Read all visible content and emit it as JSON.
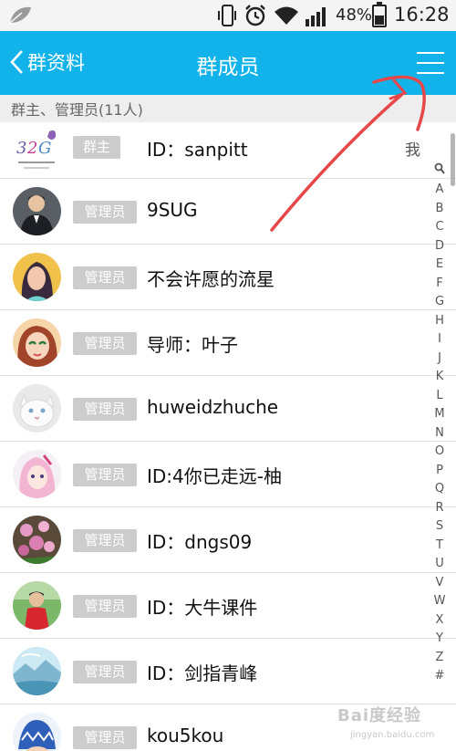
{
  "status_bar": {
    "battery_text": "48%",
    "battery_level": 0.48,
    "time": "16:28",
    "icons": [
      "leaf-icon",
      "vibrate-icon",
      "alarm-icon",
      "wifi-icon",
      "signal-icon",
      "battery-icon"
    ]
  },
  "nav": {
    "back_label": "群资料",
    "title": "群成员",
    "menu_icon": "menu-icon"
  },
  "section": {
    "title": "群主、管理员(11人)"
  },
  "members": [
    {
      "role": "群主",
      "name": "ID：sanpitt",
      "me": "我"
    },
    {
      "role": "管理员",
      "name": "9SUG"
    },
    {
      "role": "管理员",
      "name": "不会许愿的流星"
    },
    {
      "role": "管理员",
      "name": "导师：叶子"
    },
    {
      "role": "管理员",
      "name": "huweidzhuche"
    },
    {
      "role": "管理员",
      "name": "ID:4你已走远-柚"
    },
    {
      "role": "管理员",
      "name": "ID：dngs09"
    },
    {
      "role": "管理员",
      "name": "ID：大牛课件"
    },
    {
      "role": "管理员",
      "name": "ID：剑指青峰"
    },
    {
      "role": "管理员",
      "name": "kou5kou"
    }
  ],
  "index_letters": [
    "A",
    "B",
    "C",
    "D",
    "E",
    "F",
    "G",
    "H",
    "I",
    "J",
    "K",
    "L",
    "M",
    "N",
    "O",
    "P",
    "Q",
    "R",
    "S",
    "T",
    "U",
    "V",
    "W",
    "X",
    "Y",
    "Z",
    "#"
  ],
  "watermark": {
    "text": "Bai度经验",
    "subtext": "jingyan.baidu.com"
  },
  "colors": {
    "nav_bg": "#12b3ea",
    "badge_bg": "#cccccc",
    "annotation": "#e8474a"
  }
}
